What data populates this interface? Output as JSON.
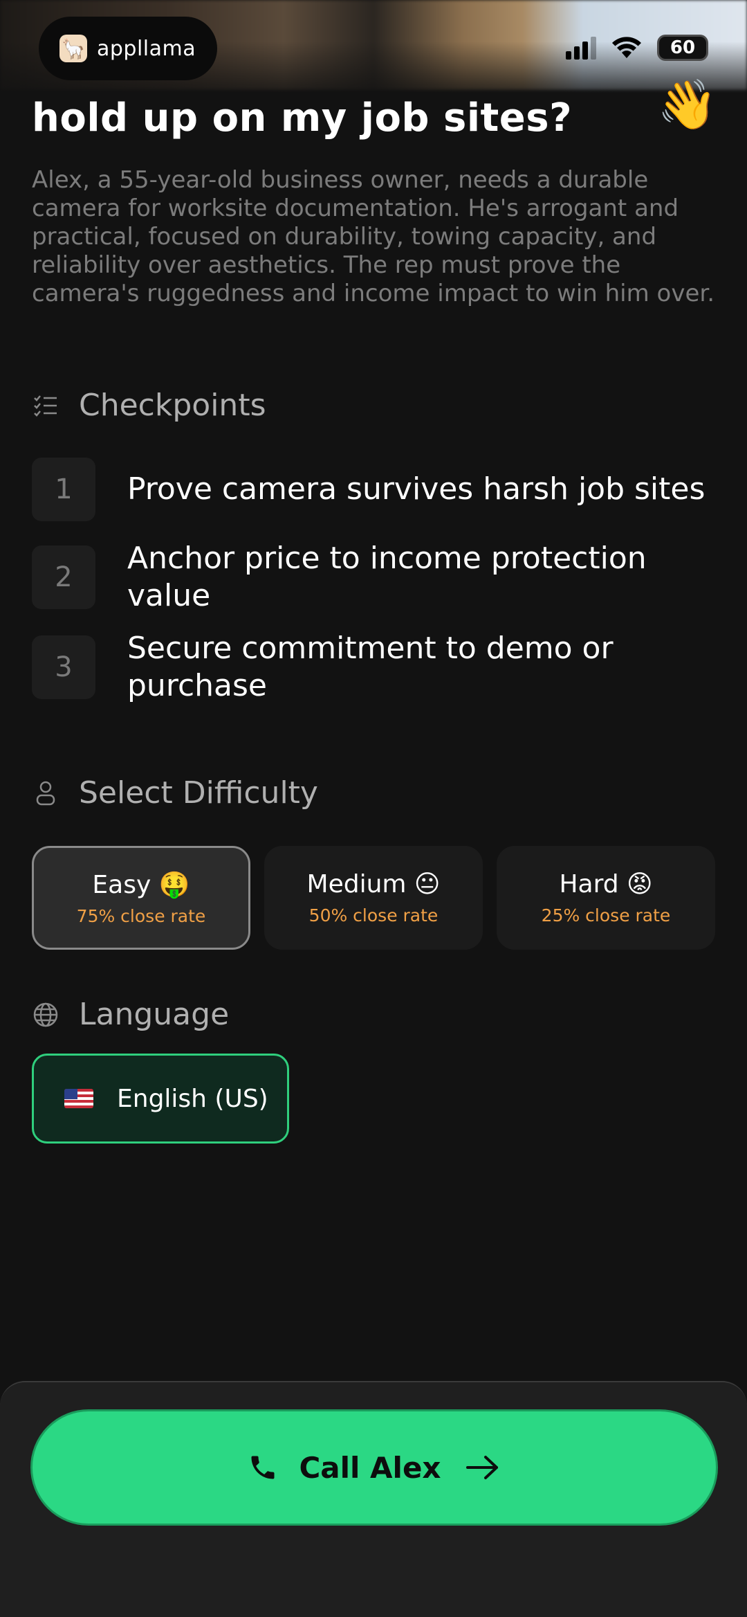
{
  "status_bar": {
    "brand_name": "appllama",
    "battery": "60",
    "icons": [
      "signal-icon",
      "wifi-icon",
      "battery-icon"
    ]
  },
  "header": {
    "title": "hold up on my job sites?",
    "emoji": "👋"
  },
  "description": "Alex, a 55-year-old business owner, needs a durable camera for worksite documentation. He's arrogant and practical, focused on durability, towing capacity, and reliability over aesthetics. The rep must prove the camera's ruggedness and income impact to win him over.",
  "checkpoints": {
    "title": "Checkpoints",
    "items": [
      {
        "num": "1",
        "text": "Prove camera survives harsh job sites"
      },
      {
        "num": "2",
        "text": "Anchor price to income protection value"
      },
      {
        "num": "3",
        "text": "Secure commitment to demo or purchase"
      }
    ]
  },
  "difficulty": {
    "title": "Select Difficulty",
    "selected": "Easy",
    "options": [
      {
        "name": "Easy 🤑",
        "rate": "75% close rate"
      },
      {
        "name": "Medium 😐",
        "rate": "50% close rate"
      },
      {
        "name": "Hard 😡",
        "rate": "25% close rate"
      }
    ]
  },
  "language": {
    "title": "Language",
    "selected": "English (US)"
  },
  "cta": {
    "label": "Call Alex"
  },
  "colors": {
    "accent": "#2bd884",
    "rate": "#f0a046",
    "background": "#121212"
  }
}
